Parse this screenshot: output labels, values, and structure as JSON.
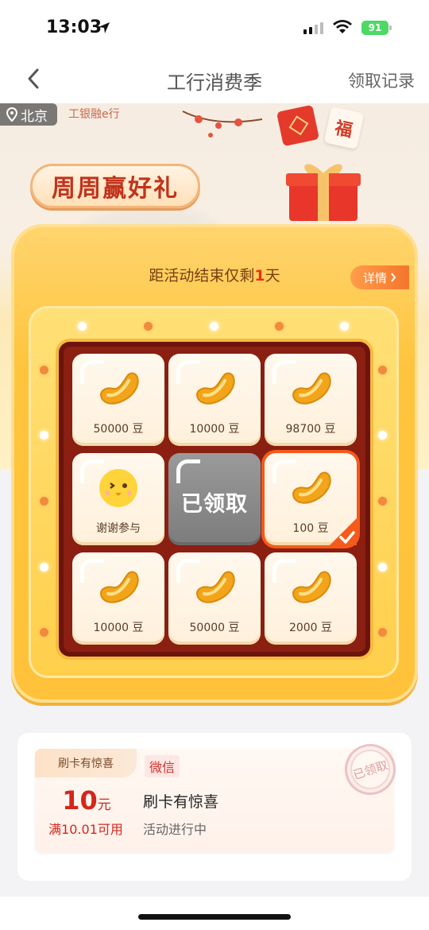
{
  "status_bar": {
    "time": "13:03",
    "battery": "91"
  },
  "nav": {
    "title": "工行消费季",
    "record_label": "领取记录"
  },
  "banner": {
    "city": "北京",
    "brand": "工银融e行",
    "headline": "周周赢好礼",
    "fu_char": "福"
  },
  "activity": {
    "countdown_prefix": "距活动结束仅剩",
    "countdown_value": "1",
    "countdown_unit": "天",
    "detail_label": "详情"
  },
  "grid": {
    "cells": [
      {
        "label": "50000 豆"
      },
      {
        "label": "10000 豆"
      },
      {
        "label": "98700 豆"
      },
      {
        "label": "谢谢参与"
      },
      {
        "label": "已领取"
      },
      {
        "label": "100 豆"
      },
      {
        "label": "10000 豆"
      },
      {
        "label": "50000 豆"
      },
      {
        "label": "2000 豆"
      }
    ]
  },
  "coupon": {
    "tag": "刷卡有惊喜",
    "channel": "微信",
    "amount": "10",
    "unit": "元",
    "condition": "满10.01可用",
    "name": "刷卡有惊喜",
    "state": "活动进行中",
    "stamp": "已领取"
  },
  "colors": {
    "accent_red": "#d4271c",
    "gold": "#ffc43d",
    "grid_bg": "#8a1f12",
    "battery_green": "#4cd964"
  }
}
